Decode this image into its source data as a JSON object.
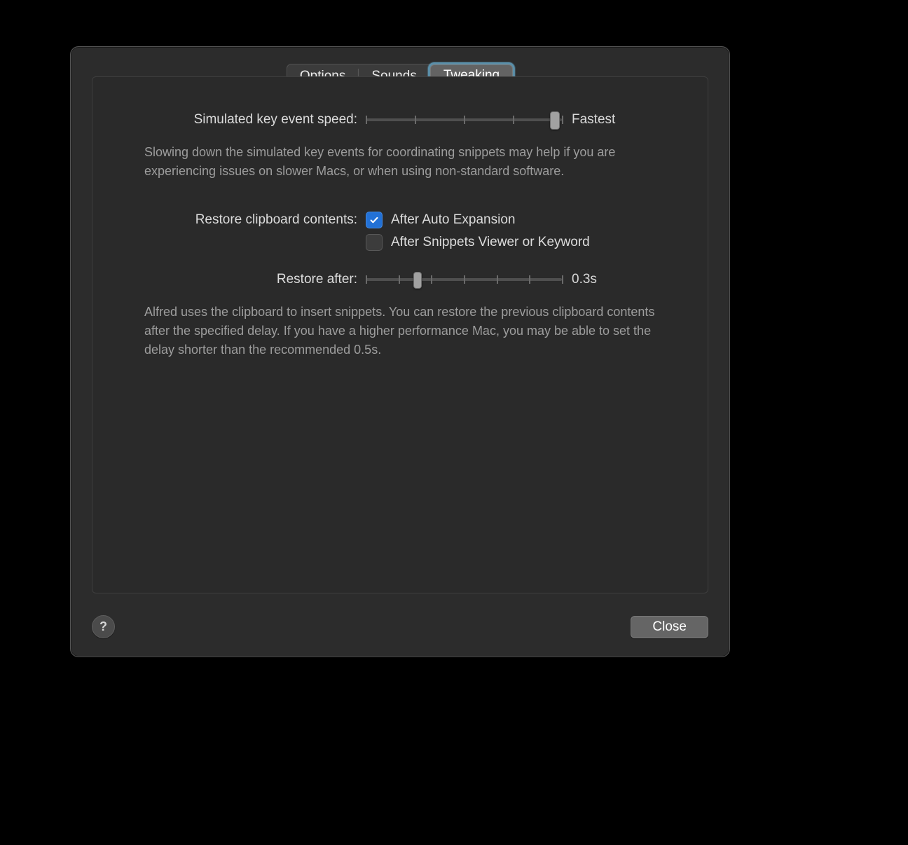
{
  "tabs": {
    "options": "Options",
    "sounds": "Sounds",
    "tweaking": "Tweaking",
    "active": "tweaking"
  },
  "speed": {
    "label": "Simulated key event speed:",
    "value_label": "Fastest",
    "ticks": 5,
    "position_pct": 96,
    "help": "Slowing down the simulated key events for coordinating snippets may help if you are experiencing issues on slower Macs, or when using non-standard software."
  },
  "restore": {
    "label": "Restore clipboard contents:",
    "opt_auto": {
      "label": "After Auto Expansion",
      "checked": true
    },
    "opt_viewer": {
      "label": "After Snippets Viewer or Keyword",
      "checked": false
    },
    "after_label": "Restore after:",
    "after_value": "0.3s",
    "after_ticks": 7,
    "after_position_pct": 26,
    "help": "Alfred uses the clipboard to insert snippets. You can restore the previous clipboard contents after the specified delay. If you have a higher performance Mac, you may be able to set the delay shorter than the recommended 0.5s."
  },
  "footer": {
    "help": "?",
    "close": "Close"
  }
}
